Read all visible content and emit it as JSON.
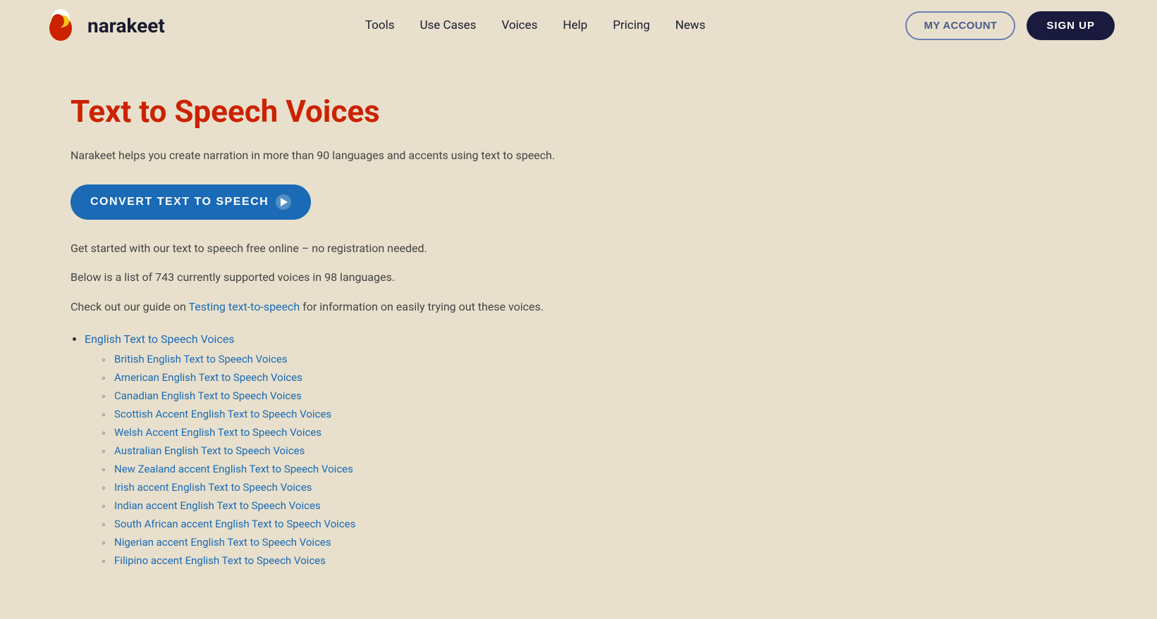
{
  "header": {
    "logo_text": "narakeet",
    "nav_items": [
      {
        "label": "Tools",
        "href": "#"
      },
      {
        "label": "Use Cases",
        "href": "#"
      },
      {
        "label": "Voices",
        "href": "#"
      },
      {
        "label": "Help",
        "href": "#"
      },
      {
        "label": "Pricing",
        "href": "#"
      },
      {
        "label": "News",
        "href": "#"
      }
    ],
    "my_account_label": "MY ACCOUNT",
    "sign_up_label": "SIGN UP"
  },
  "main": {
    "page_title": "Text to Speech Voices",
    "subtitle": "Narakeet helps you create narration in more than 90 languages and accents using text to speech.",
    "cta_button_label": "CONVERT TEXT TO SPEECH",
    "description1": "Get started with our text to speech free online – no registration needed.",
    "description2": "Below is a list of 743 currently supported voices in 98 languages.",
    "description3_prefix": "Check out our guide on ",
    "description3_link_text": "Testing text-to-speech",
    "description3_suffix": " for information on easily trying out these voices.",
    "voice_list": [
      {
        "label": "English Text to Speech Voices",
        "sublist": [
          "British English Text to Speech Voices",
          "American English Text to Speech Voices",
          "Canadian English Text to Speech Voices",
          "Scottish Accent English Text to Speech Voices",
          "Welsh Accent English Text to Speech Voices",
          "Australian English Text to Speech Voices",
          "New Zealand accent English Text to Speech Voices",
          "Irish accent English Text to Speech Voices",
          "Indian accent English Text to Speech Voices",
          "South African accent English Text to Speech Voices",
          "Nigerian accent English Text to Speech Voices",
          "Filipino accent English Text to Speech Voices"
        ]
      }
    ]
  }
}
